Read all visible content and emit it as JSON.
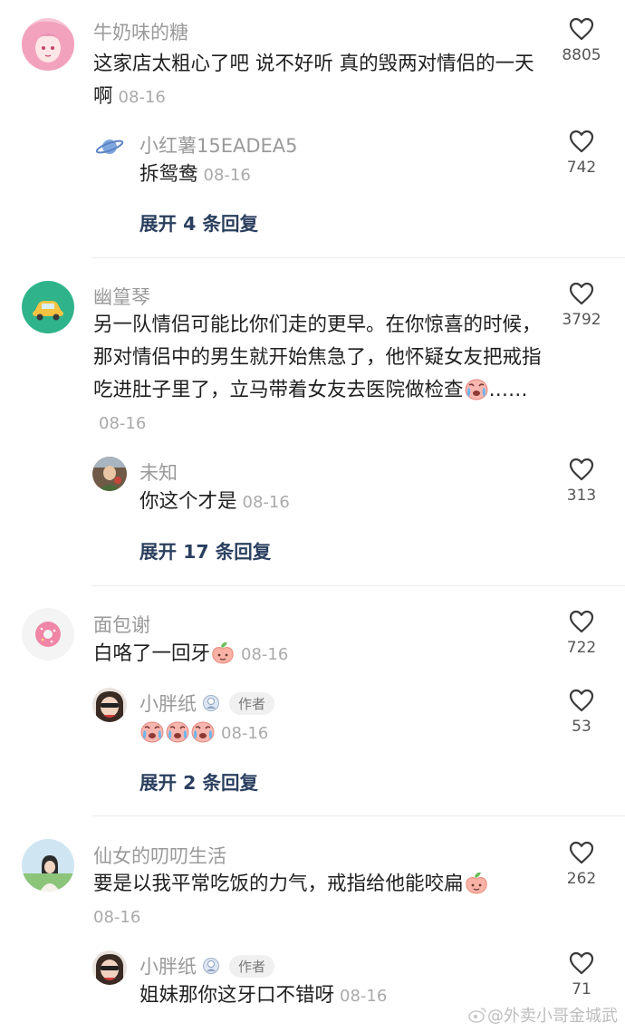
{
  "comments": [
    {
      "author": "牛奶味的糖",
      "text": "这家店太粗心了吧 说不好听 真的毁两对情侣的一天啊",
      "date": "08-16",
      "likes": "8805",
      "reply": {
        "author": "小红薯15EADEA5",
        "text": "拆鸳鸯",
        "date": "08-16",
        "likes": "742"
      },
      "expand": "展开 4 条回复"
    },
    {
      "author": "幽篁琴",
      "text": "另一队情侣可能比你们走的更早。在你惊喜的时候，那对情侣中的男生就开始焦急了，他怀疑女友把戒指吃进肚子里了，立马带着女友去医院做检查",
      "text_tail": "……",
      "date": "08-16",
      "likes": "3792",
      "reply": {
        "author": "未知",
        "text": "你这个才是",
        "date": "08-16",
        "likes": "313"
      },
      "expand": "展开 17 条回复"
    },
    {
      "author": "面包谢",
      "text": "白咯了一回牙",
      "date": "08-16",
      "likes": "722",
      "reply": {
        "author": "小胖纸",
        "badge": "作者",
        "text": "",
        "date": "08-16",
        "likes": "53"
      },
      "expand": "展开 2 条回复"
    },
    {
      "author": "仙女的叨叨生活",
      "text": "要是以我平常吃饭的力气，戒指给他能咬扁",
      "date": "08-16",
      "likes": "262",
      "reply": {
        "author": "小胖纸",
        "badge": "作者",
        "text": "姐妹那你这牙口不错呀",
        "date": "08-16",
        "likes": "71"
      }
    }
  ],
  "watermark": "@外卖小哥金城武",
  "icons": {
    "like": "heart-outline-icon",
    "vip": "vip-badge-icon",
    "emoji_cry": "crying-face-emoji",
    "emoji_peach": "peach-emoji"
  },
  "colors": {
    "expand_link": "#2a3f5f",
    "meta": "#9a9a9a",
    "text": "#1f1f1f"
  }
}
